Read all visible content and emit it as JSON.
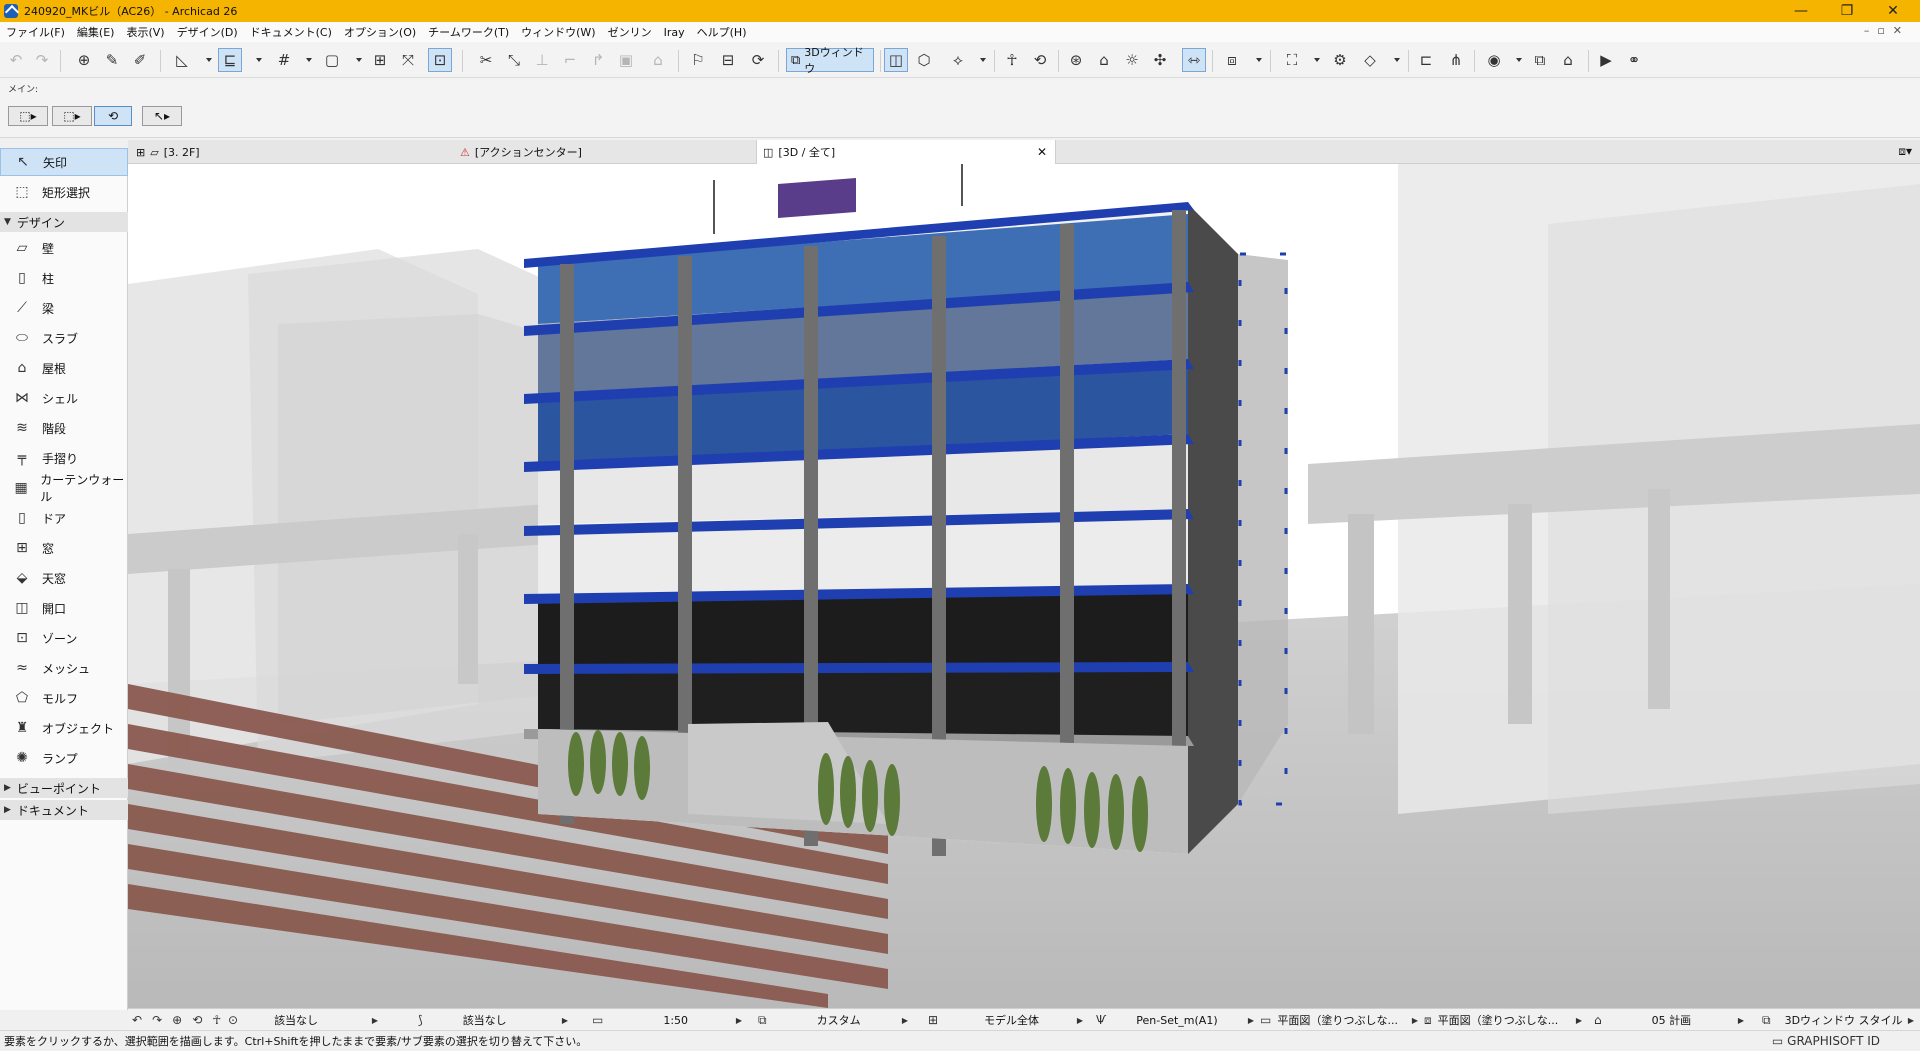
{
  "window": {
    "title": "240920_MKビル（AC26） - Archicad 26",
    "minimize": "—",
    "restore": "❐",
    "close": "✕"
  },
  "menu": [
    "ファイル(F)",
    "編集(E)",
    "表示(V)",
    "デザイン(D)",
    "ドキュメント(C)",
    "オプション(O)",
    "チームワーク(T)",
    "ウィンドウ(W)",
    "ゼンリン",
    "Iray",
    "ヘルプ(H)"
  ],
  "toolbar": {
    "window3d_label": "3Dウィンドウ"
  },
  "infobox": {
    "label": "メイン:"
  },
  "toolbox": {
    "arrow": "矢印",
    "marquee": "矩形選択",
    "group_design": "デザイン",
    "tools": [
      "壁",
      "柱",
      "梁",
      "スラブ",
      "屋根",
      "シェル",
      "階段",
      "手摺り",
      "カーテンウォール",
      "ドア",
      "窓",
      "天窓",
      "開口",
      "ゾーン",
      "メッシュ",
      "モルフ",
      "オブジェクト",
      "ランプ"
    ],
    "group_viewpoint": "ビューポイント",
    "group_document": "ドキュメント"
  },
  "tabs": {
    "floor": "[3. 2F]",
    "action_center": "[アクションセンター]",
    "view3d": "[3D / 全て]"
  },
  "status": {
    "ref1": "該当なし",
    "ref2": "該当なし",
    "scale": "1:50",
    "layer": "カスタム",
    "model_view": "モデル全体",
    "pen_set": "Pen-Set_m(A1)",
    "override1": "平面図（塗りつぶしな...",
    "override2": "平面図（塗りつぶしな...",
    "renovation": "05 計画",
    "style3d": "3Dウィンドウ スタイル"
  },
  "hint": "要素をクリックするか、選択範囲を描画します。Ctrl+Shiftを押したままで要素/サブ要素の選択を切り替えて下さい。",
  "graphisoft_id": "GRAPHISOFT ID",
  "colors": {
    "titlebar": "#f5b400",
    "beam": "#1f3fb0",
    "selected": "#cfe3f7"
  }
}
